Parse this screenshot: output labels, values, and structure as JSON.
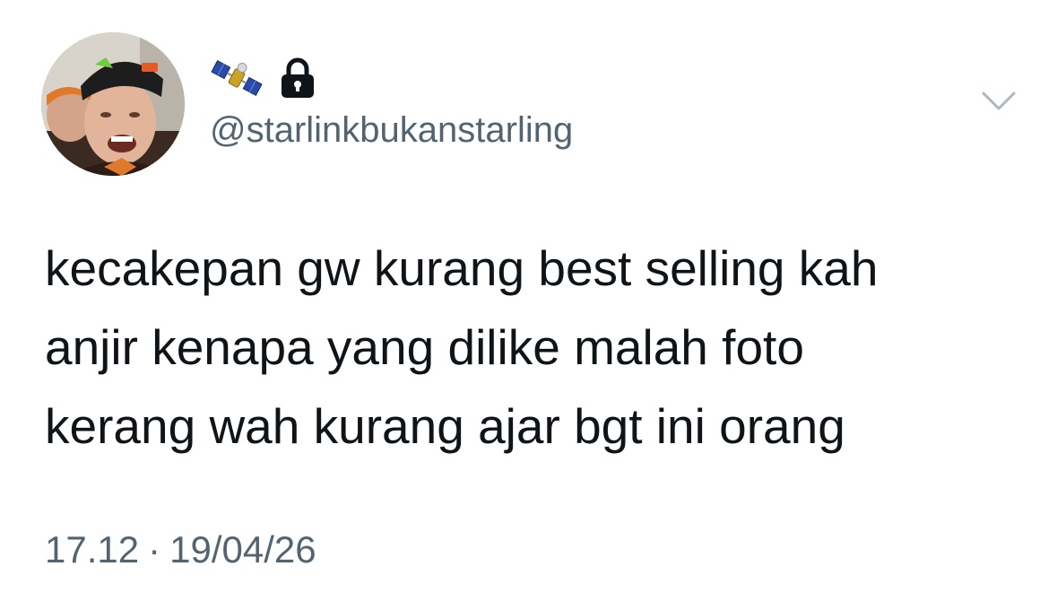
{
  "tweet": {
    "avatar_icon": "profile-photo",
    "display_name_icons": [
      "satellite-emoji",
      "lock-icon"
    ],
    "handle": "@starlinkbukanstarling",
    "menu_icon": "chevron-down-icon",
    "text_lines": [
      "kecakepan gw kurang best selling kah",
      "anjir kenapa yang dilike malah foto",
      "kerang wah kurang ajar bgt ini orang"
    ],
    "time": "17.12",
    "separator": "·",
    "date": "19/04/26"
  },
  "colors": {
    "text": "#0f1419",
    "secondary": "#536471",
    "chevron": "#aab8c2",
    "background": "#ffffff"
  }
}
